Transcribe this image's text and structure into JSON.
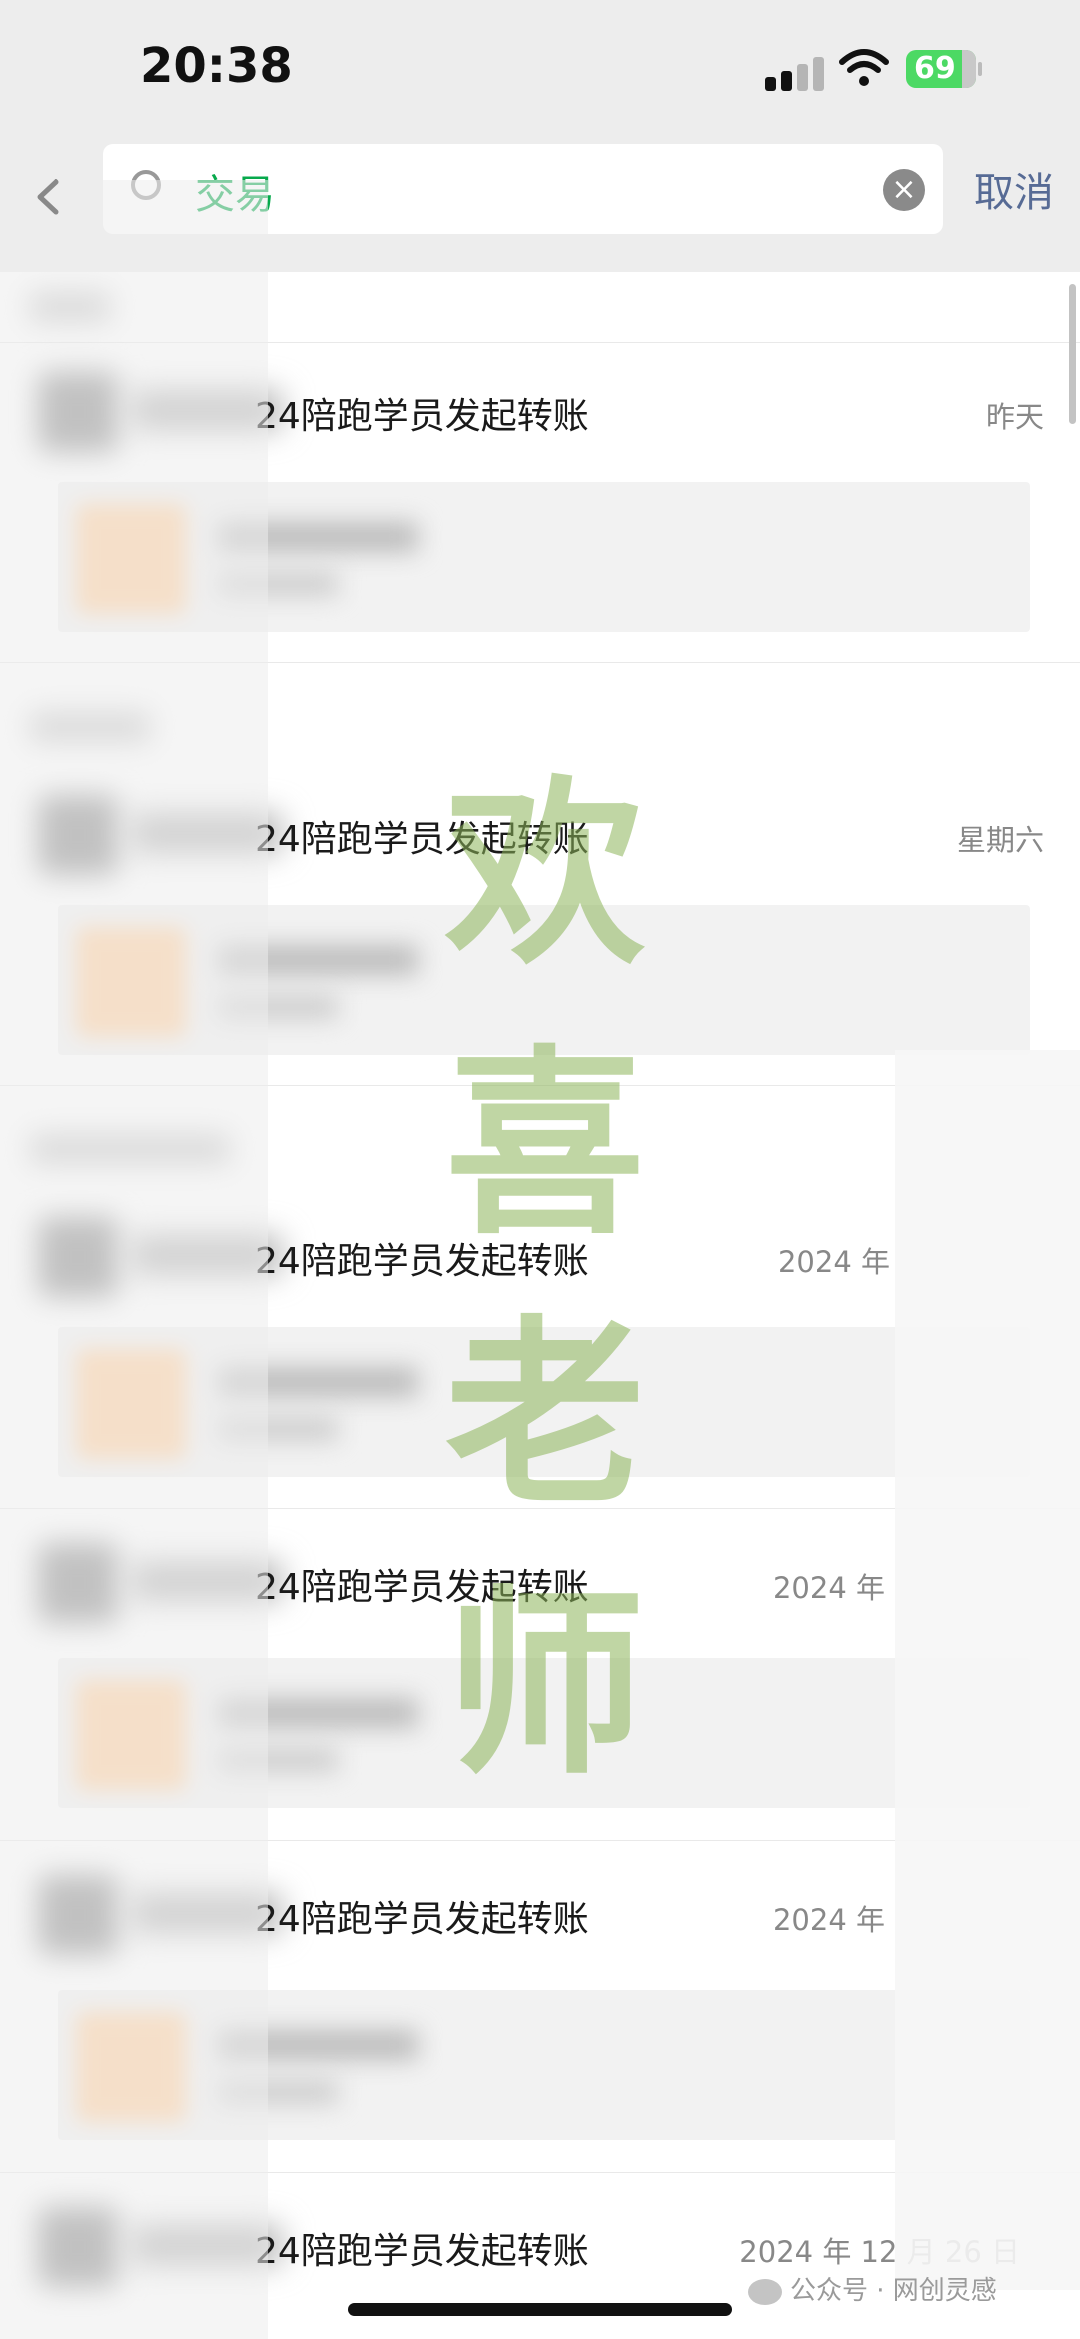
{
  "status_bar": {
    "time": "20:38",
    "battery": "69",
    "icons": [
      "signal-icon",
      "wifi-icon",
      "battery-charging-icon"
    ]
  },
  "search": {
    "query": "交易",
    "cancel_label": "取消",
    "icons": [
      "back-chevron-icon",
      "search-icon",
      "clear-icon"
    ]
  },
  "results": [
    {
      "title": "24陪跑学员发起转账",
      "date": "昨天"
    },
    {
      "title": "24陪跑学员发起转账",
      "date": "星期六"
    },
    {
      "title": "24陪跑学员发起转账",
      "date": "2024 年"
    },
    {
      "title": "24陪跑学员发起转账",
      "date": "2024 年"
    },
    {
      "title": "24陪跑学员发起转账",
      "date": "2024 年"
    },
    {
      "title": "24陪跑学员发起转账",
      "date": "2024 年 12 月 26 日"
    }
  ],
  "watermark": {
    "chars": [
      "欢",
      "喜",
      "老",
      "师"
    ],
    "source": "公众号 · 网创灵感",
    "color": "#8cb45a"
  },
  "colors": {
    "accent": "#07a94c",
    "link": "#576b95",
    "battery": "#4cd964"
  }
}
